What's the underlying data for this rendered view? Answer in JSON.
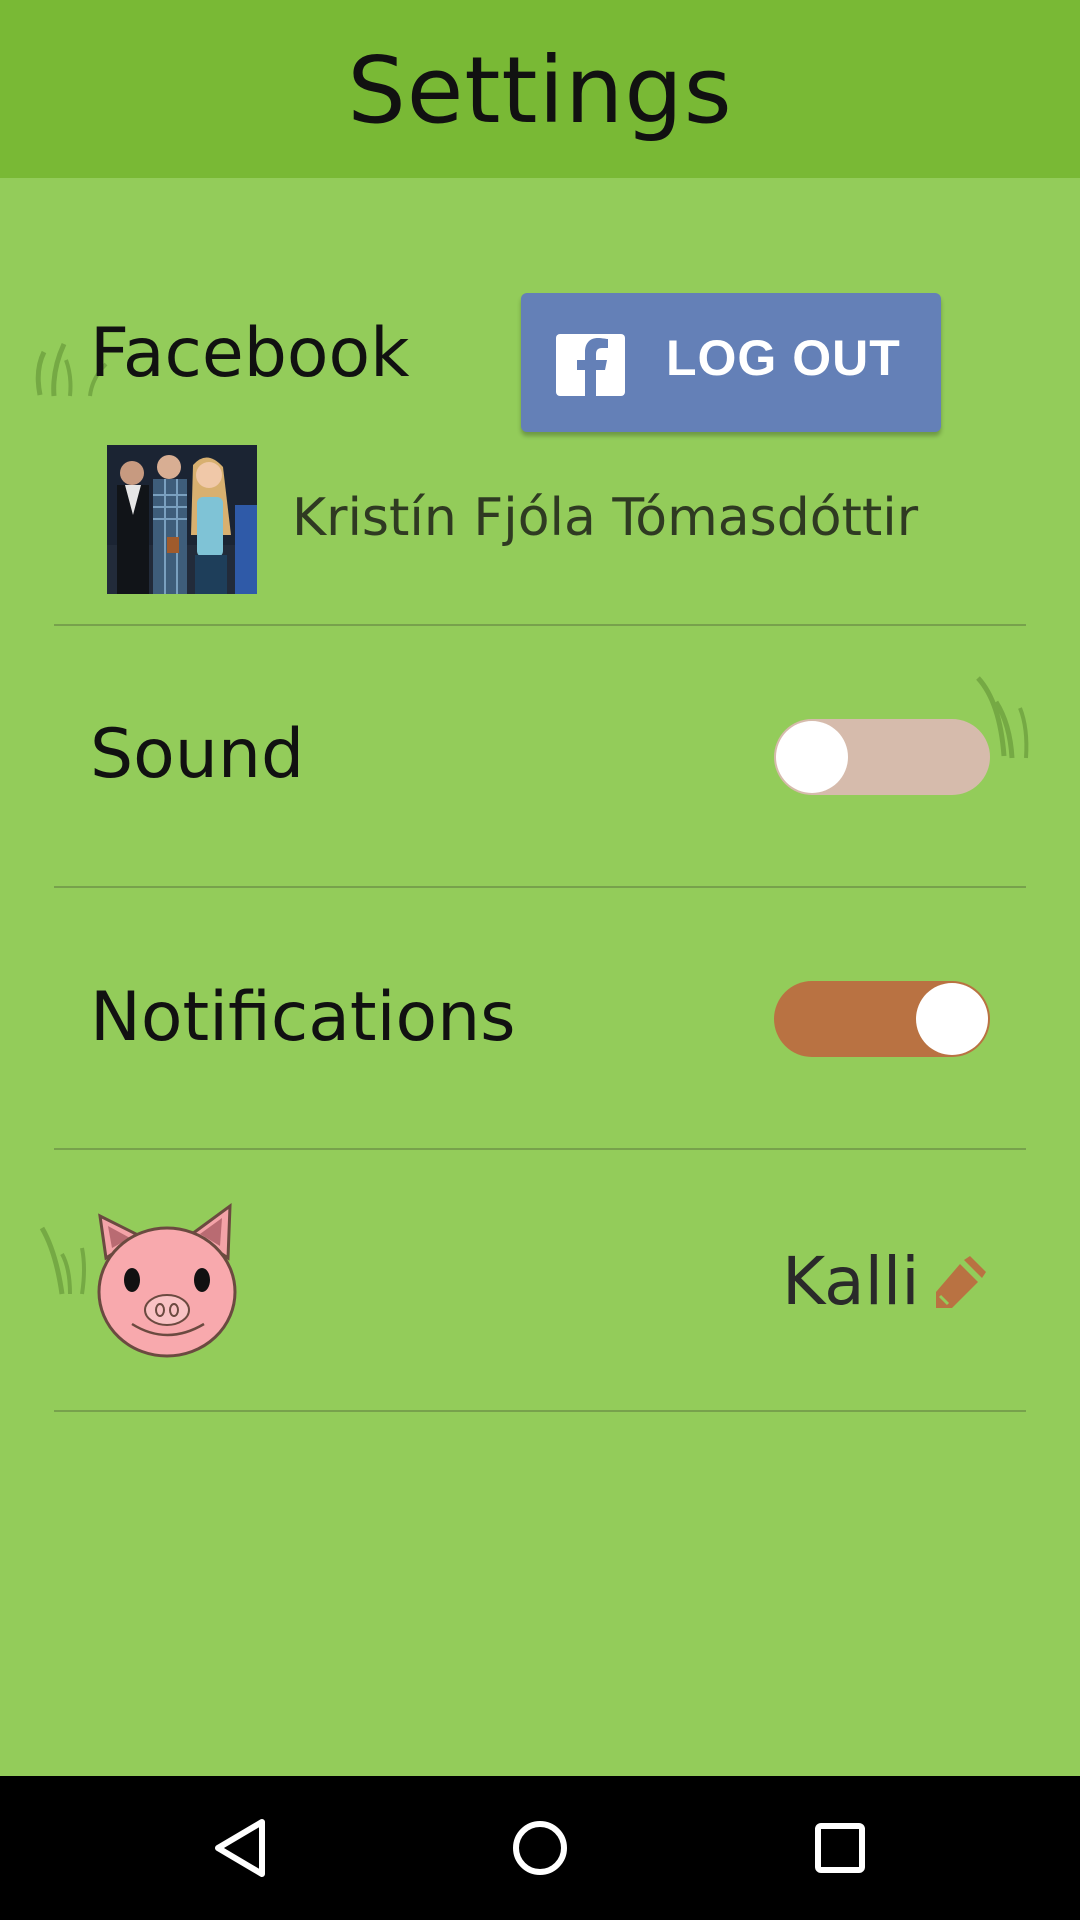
{
  "app_bar": {
    "title": "Settings",
    "color": "#79b935"
  },
  "theme": {
    "background": "#93cc5a",
    "accent": "#b97242",
    "toggle_off_track": "#d6bbac"
  },
  "facebook": {
    "label": "Facebook",
    "button_label": "LOG OUT",
    "button_icon": "facebook-f-icon",
    "button_color": "#6480b7",
    "user_name": "Kristín Fjóla Tómasdóttir"
  },
  "sound": {
    "label": "Sound",
    "enabled": false
  },
  "notifications": {
    "label": "Notifications",
    "enabled": true
  },
  "pet": {
    "avatar_icon": "pig-face-icon",
    "name": "Kalli",
    "edit_icon": "pencil-icon"
  },
  "nav_bar": {
    "buttons": [
      "back-icon",
      "home-icon",
      "recents-icon"
    ]
  }
}
